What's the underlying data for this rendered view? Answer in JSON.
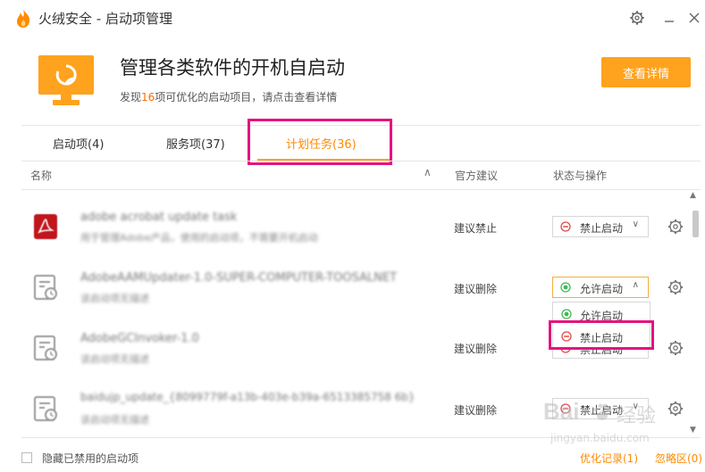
{
  "app": {
    "title": "火绒安全 - 启动项管理"
  },
  "header": {
    "headline": "管理各类软件的开机自启动",
    "sub_prefix": "发现",
    "sub_count": "16",
    "sub_suffix": "项可优化的启动项目，请点击查看详情",
    "detail_button": "查看详情"
  },
  "tabs": [
    {
      "label": "启动项(4)"
    },
    {
      "label": "服务项(37)"
    },
    {
      "label": "计划任务(36)",
      "active": true
    }
  ],
  "columns": {
    "name": "名称",
    "advice": "官方建议",
    "status": "状态与操作"
  },
  "rows": [
    {
      "name": "adobe acrobat update task",
      "desc": "用于管理Adobe产品，使用的启动项，不需要开机启动",
      "advice": "建议禁止",
      "status": "禁止启动",
      "icon": "acrobat-icon"
    },
    {
      "name": "AdobeAAMUpdater-1.0-SUPER-COMPUTER-TOOSALNET",
      "desc": "该启动项无描述",
      "advice": "建议删除",
      "status": "允许启动",
      "icon": "scheduled-task-icon"
    },
    {
      "name": "AdobeGCInvoker-1.0",
      "desc": "该启动项无描述",
      "advice": "建议删除",
      "status": "禁止启动",
      "icon": "scheduled-task-icon"
    },
    {
      "name": "baidujp_update_{8099779f-a13b-403e-b39a-6513385758 6b}",
      "desc": "该启动项无描述",
      "advice": "建议删除",
      "status": "禁止启动",
      "icon": "scheduled-task-icon"
    }
  ],
  "dropdown": {
    "options": [
      "允许启动",
      "禁止启动"
    ]
  },
  "footer": {
    "hide_disabled": "隐藏已禁用的启动项",
    "history_link": "优化记录(1)",
    "ignore_link": "忽略区(0)"
  },
  "watermark": {
    "brand": "Bai",
    "brand2": "经验",
    "url": "jingyan.baidu.com"
  },
  "colors": {
    "accent": "#ffa21d",
    "highlight": "#e5137f",
    "allow": "#3cba54",
    "deny": "#e04848"
  }
}
